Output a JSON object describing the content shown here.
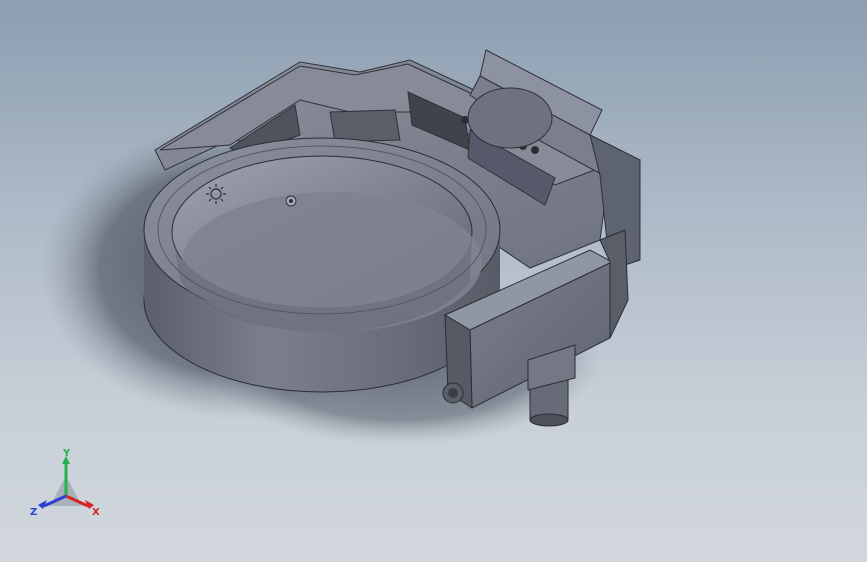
{
  "viewport": {
    "background_top": "#8d9eb1",
    "background_bottom": "#d2d7dd",
    "part_color": "#6f7480"
  },
  "model": {
    "description_icon": "ring-motor-housing-3d-model"
  },
  "triad": {
    "x_label": "X",
    "y_label": "Y",
    "z_label": "Z",
    "x_color": "#d42424",
    "y_color": "#22b34a",
    "z_color": "#2a3fd1"
  }
}
